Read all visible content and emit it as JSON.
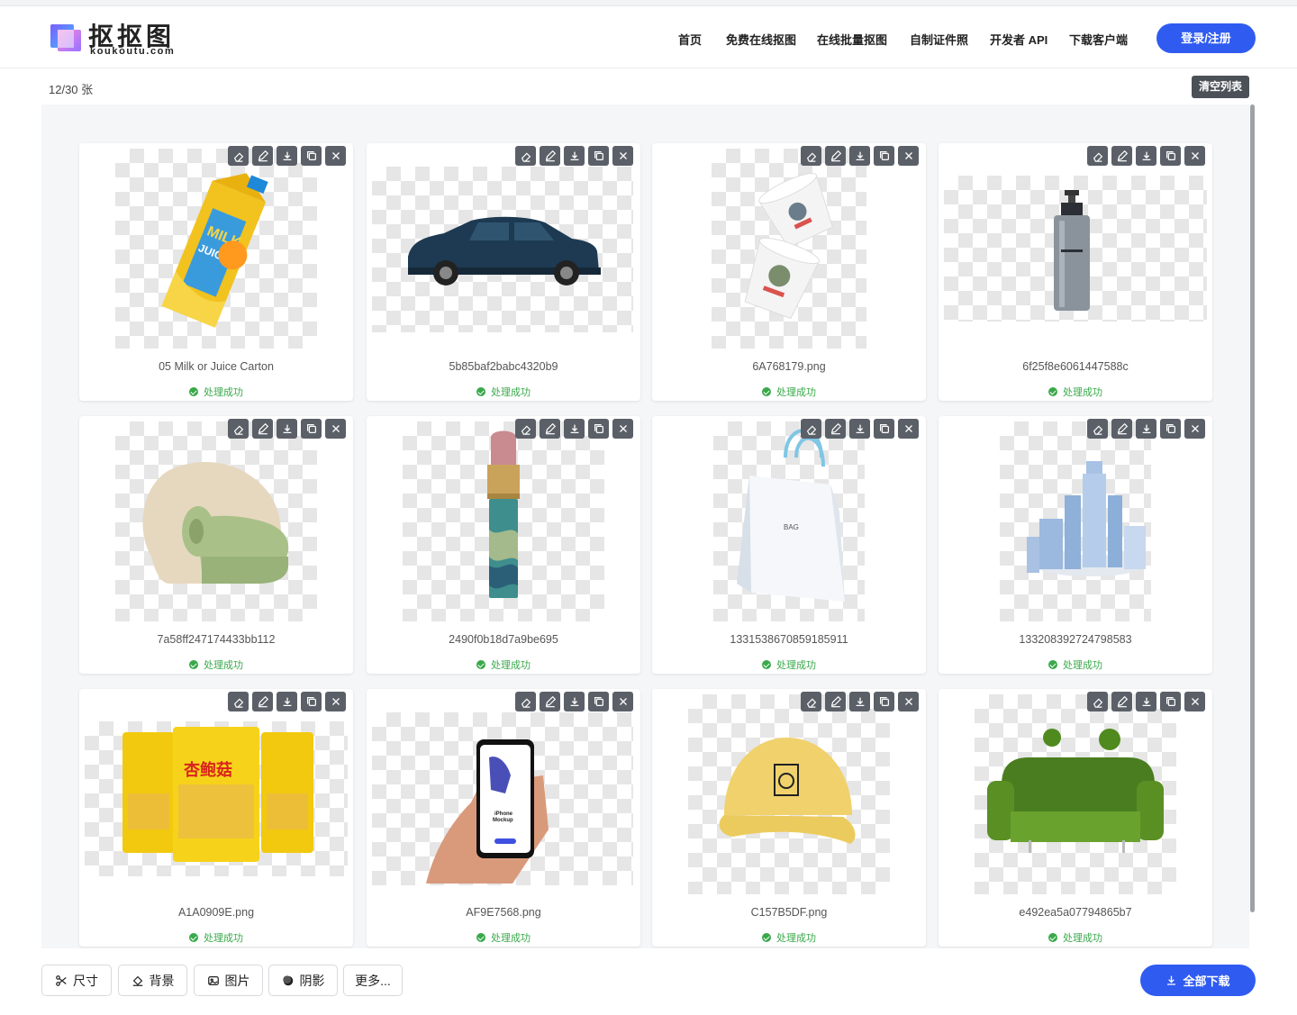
{
  "brand": {
    "name": "抠抠图",
    "domain": "koukoutu.com"
  },
  "nav": [
    {
      "label": "首页"
    },
    {
      "label": "免费在线抠图"
    },
    {
      "label": "在线批量抠图"
    },
    {
      "label": "自制证件照"
    },
    {
      "label": "开发者 API"
    },
    {
      "label": "下载客户端"
    }
  ],
  "login_label": "登录/注册",
  "count_label": "12/30 张",
  "clear_label": "清空列表",
  "status_text": "处理成功",
  "cards": [
    {
      "name": "05 Milk or Juice Carton",
      "status": "处理成功",
      "subject": "milk-carton"
    },
    {
      "name": "5b85baf2babc4320b9",
      "status": "处理成功",
      "subject": "suv-car"
    },
    {
      "name": "6A768179.png",
      "status": "处理成功",
      "subject": "paper-cups"
    },
    {
      "name": "6f25f8e6061447588c",
      "status": "处理成功",
      "subject": "pump-bottle"
    },
    {
      "name": "7a58ff247174433bb112",
      "status": "处理成功",
      "subject": "armchair"
    },
    {
      "name": "2490f0b18d7a9be695",
      "status": "处理成功",
      "subject": "lipstick"
    },
    {
      "name": "1331538670859185911",
      "status": "处理成功",
      "subject": "gift-bag"
    },
    {
      "name": "133208392724798583",
      "status": "处理成功",
      "subject": "cosmetic-bottles"
    },
    {
      "name": "A1A0909E.png",
      "status": "处理成功",
      "subject": "snack-bags"
    },
    {
      "name": "AF9E7568.png",
      "status": "处理成功",
      "subject": "phone-mockup"
    },
    {
      "name": "C157B5DF.png",
      "status": "处理成功",
      "subject": "yellow-cap"
    },
    {
      "name": "e492ea5a07794865b7",
      "status": "处理成功",
      "subject": "moss-sofa"
    }
  ],
  "card_tools": [
    "eraser-icon",
    "edit-icon",
    "download-icon",
    "copy-icon",
    "close-icon"
  ],
  "bottom_options": [
    {
      "label": "尺寸",
      "icon": "scissors-icon"
    },
    {
      "label": "背景",
      "icon": "paint-bucket-icon"
    },
    {
      "label": "图片",
      "icon": "image-icon"
    },
    {
      "label": "阴影",
      "icon": "shadow-icon"
    },
    {
      "label": "更多...",
      "icon": ""
    }
  ],
  "download_all_label": "全部下载",
  "colors": {
    "accent": "#2f5bf1",
    "success": "#3aa94b",
    "tool_bg": "#5b6068"
  }
}
